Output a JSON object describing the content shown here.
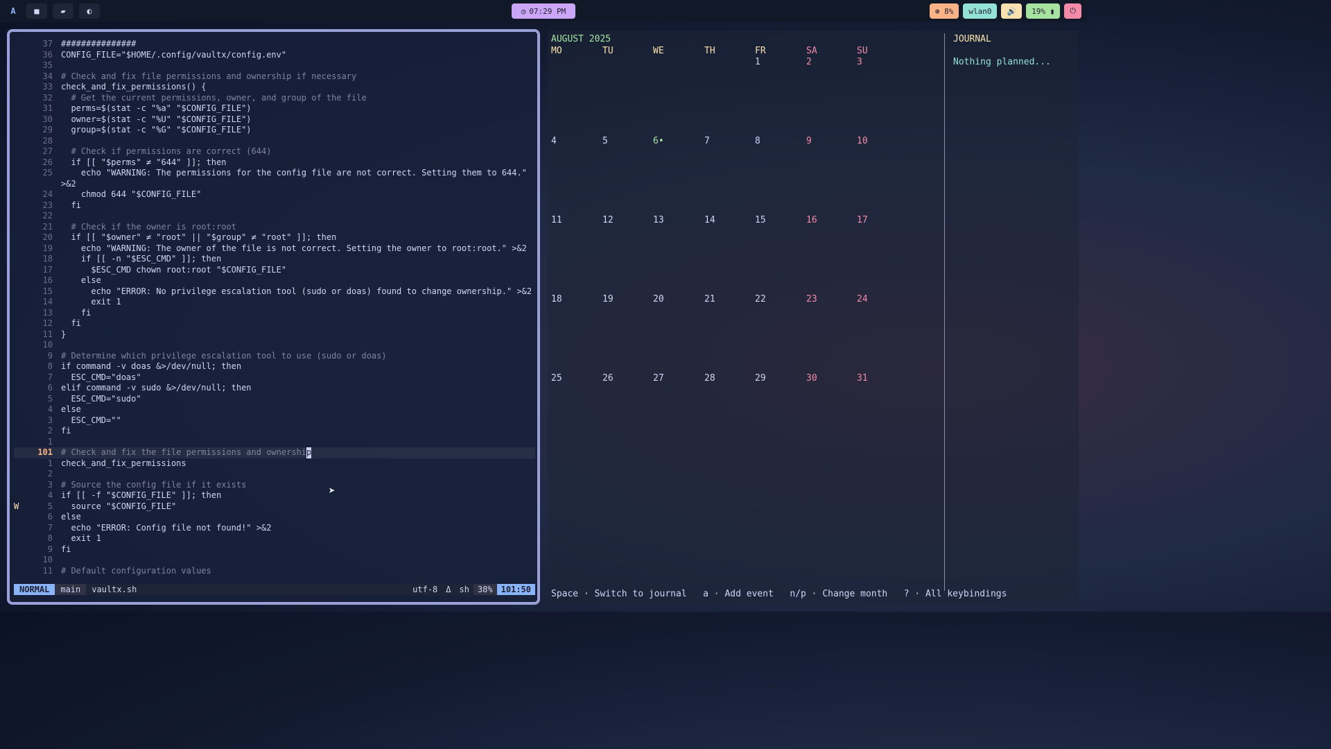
{
  "topbar": {
    "logo": "A",
    "btn_terminal": "■",
    "btn_files": "▰",
    "btn_power": "◐",
    "clock": "07:29 PM",
    "cpu": "8%",
    "wlan": "wlan0",
    "volume_icon": "🔊",
    "battery": "19%",
    "power_icon": "⏻"
  },
  "editor": {
    "lines": [
      {
        "n": "37",
        "t": "###############"
      },
      {
        "n": "36",
        "t": "CONFIG_FILE=\"$HOME/.config/vaultx/config.env\""
      },
      {
        "n": "35",
        "t": ""
      },
      {
        "n": "34",
        "t": "# Check and fix file permissions and ownership if necessary",
        "c": true
      },
      {
        "n": "33",
        "t": "check_and_fix_permissions() {"
      },
      {
        "n": "32",
        "t": "  # Get the current permissions, owner, and group of the file",
        "c": true
      },
      {
        "n": "31",
        "t": "  perms=$(stat -c \"%a\" \"$CONFIG_FILE\")"
      },
      {
        "n": "30",
        "t": "  owner=$(stat -c \"%U\" \"$CONFIG_FILE\")"
      },
      {
        "n": "29",
        "t": "  group=$(stat -c \"%G\" \"$CONFIG_FILE\")"
      },
      {
        "n": "28",
        "t": ""
      },
      {
        "n": "27",
        "t": "  # Check if permissions are correct (644)",
        "c": true
      },
      {
        "n": "26",
        "t": "  if [[ \"$perms\" ≠ \"644\" ]]; then"
      },
      {
        "n": "25",
        "t": "    echo \"WARNING: The permissions for the config file are not correct. Setting them to 644.\""
      },
      {
        "n": "",
        "t": ">&2"
      },
      {
        "n": "24",
        "t": "    chmod 644 \"$CONFIG_FILE\""
      },
      {
        "n": "23",
        "t": "  fi"
      },
      {
        "n": "22",
        "t": ""
      },
      {
        "n": "21",
        "t": "  # Check if the owner is root:root",
        "c": true
      },
      {
        "n": "20",
        "t": "  if [[ \"$owner\" ≠ \"root\" || \"$group\" ≠ \"root\" ]]; then"
      },
      {
        "n": "19",
        "t": "    echo \"WARNING: The owner of the file is not correct. Setting the owner to root:root.\" >&2"
      },
      {
        "n": "18",
        "t": "    if [[ -n \"$ESC_CMD\" ]]; then"
      },
      {
        "n": "17",
        "t": "      $ESC_CMD chown root:root \"$CONFIG_FILE\""
      },
      {
        "n": "16",
        "t": "    else"
      },
      {
        "n": "15",
        "t": "      echo \"ERROR: No privilege escalation tool (sudo or doas) found to change ownership.\" >&2"
      },
      {
        "n": "14",
        "t": "      exit 1"
      },
      {
        "n": "13",
        "t": "    fi"
      },
      {
        "n": "12",
        "t": "  fi"
      },
      {
        "n": "11",
        "t": "}"
      },
      {
        "n": "10",
        "t": ""
      },
      {
        "n": "9",
        "t": "# Determine which privilege escalation tool to use (sudo or doas)",
        "c": true
      },
      {
        "n": "8",
        "t": "if command -v doas &>/dev/null; then"
      },
      {
        "n": "7",
        "t": "  ESC_CMD=\"doas\""
      },
      {
        "n": "6",
        "t": "elif command -v sudo &>/dev/null; then"
      },
      {
        "n": "5",
        "t": "  ESC_CMD=\"sudo\""
      },
      {
        "n": "4",
        "t": "else"
      },
      {
        "n": "3",
        "t": "  ESC_CMD=\"\""
      },
      {
        "n": "2",
        "t": "fi"
      },
      {
        "n": "1",
        "t": ""
      },
      {
        "n": "101",
        "t": "# Check and fix the file permissions and ownershi",
        "cursor": "p",
        "c": true,
        "cur": true
      },
      {
        "n": "1",
        "t": "check_and_fix_permissions"
      },
      {
        "n": "2",
        "t": ""
      },
      {
        "n": "3",
        "t": "# Source the config file if it exists",
        "c": true
      },
      {
        "n": "4",
        "t": "if [[ -f \"$CONFIG_FILE\" ]]; then"
      },
      {
        "n": "5",
        "t": "  source \"$CONFIG_FILE\"",
        "g": "W"
      },
      {
        "n": "6",
        "t": "else"
      },
      {
        "n": "7",
        "t": "  echo \"ERROR: Config file not found!\" >&2"
      },
      {
        "n": "8",
        "t": "  exit 1"
      },
      {
        "n": "9",
        "t": "fi"
      },
      {
        "n": "10",
        "t": ""
      },
      {
        "n": "11",
        "t": "# Default configuration values",
        "c": true
      }
    ],
    "status": {
      "mode": "NORMAL",
      "branch": " main",
      "file": "vaultx.sh",
      "encoding": "utf-8",
      "os_icon": "Δ",
      "filetype": "sh",
      "percent": "38%",
      "position": "101:50"
    }
  },
  "calendar": {
    "title": "AUGUST 2025",
    "weekdays": [
      "MO",
      "TU",
      "WE",
      "TH",
      "FR",
      "SA",
      "SU"
    ],
    "weeks": [
      [
        "",
        "",
        "",
        "",
        "1",
        "2",
        "3"
      ],
      [
        "4",
        "5",
        "6•",
        "7",
        "8",
        "9",
        "10"
      ],
      [
        "11",
        "12",
        "13",
        "14",
        "15",
        "16",
        "17"
      ],
      [
        "18",
        "19",
        "20",
        "21",
        "22",
        "23",
        "24"
      ],
      [
        "25",
        "26",
        "27",
        "28",
        "29",
        "30",
        "31"
      ]
    ],
    "journal_title": "JOURNAL",
    "journal_empty": "Nothing planned...",
    "help": "Space · Switch to journal   a · Add event   n/p · Change month   ? · All keybindings"
  }
}
